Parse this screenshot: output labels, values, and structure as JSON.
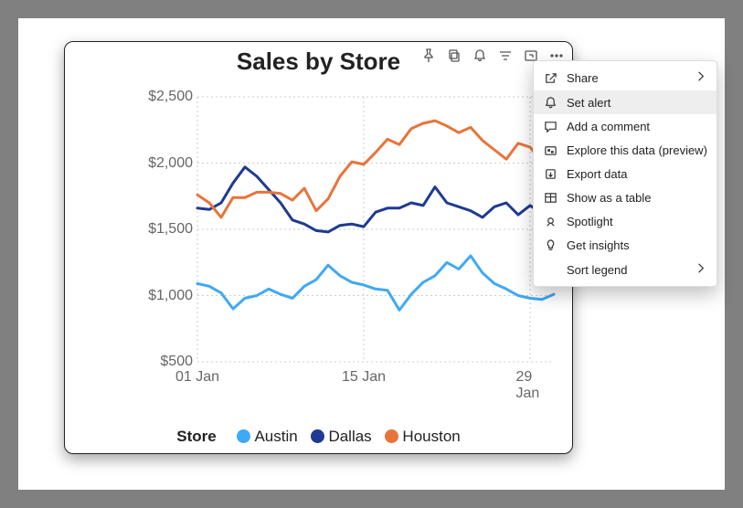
{
  "title": "Sales by Store",
  "y_ticks": [
    "$2,500",
    "$2,000",
    "$1,500",
    "$1,000",
    "$500"
  ],
  "x_ticks": [
    "01 Jan",
    "15 Jan",
    "29 Jan"
  ],
  "legend_title": "Store",
  "legend": [
    {
      "label": "Austin",
      "color": "#3fa9f5"
    },
    {
      "label": "Dallas",
      "color": "#1f3a93"
    },
    {
      "label": "Houston",
      "color": "#e8743b"
    }
  ],
  "menu": {
    "share": "Share",
    "set_alert": "Set alert",
    "add_comment": "Add a comment",
    "explore": "Explore this data (preview)",
    "export": "Export data",
    "show_table": "Show as a table",
    "spotlight": "Spotlight",
    "insights": "Get insights",
    "sort_legend": "Sort legend"
  },
  "chart_data": {
    "type": "line",
    "title": "Sales by Store",
    "xlabel": "",
    "ylabel": "",
    "ylim": [
      500,
      2500
    ],
    "x": [
      "01 Jan",
      "02 Jan",
      "03 Jan",
      "04 Jan",
      "05 Jan",
      "06 Jan",
      "07 Jan",
      "08 Jan",
      "09 Jan",
      "10 Jan",
      "11 Jan",
      "12 Jan",
      "13 Jan",
      "14 Jan",
      "15 Jan",
      "16 Jan",
      "17 Jan",
      "18 Jan",
      "19 Jan",
      "20 Jan",
      "21 Jan",
      "22 Jan",
      "23 Jan",
      "24 Jan",
      "25 Jan",
      "26 Jan",
      "27 Jan",
      "28 Jan",
      "29 Jan",
      "30 Jan",
      "31 Jan"
    ],
    "series": [
      {
        "name": "Austin",
        "color": "#3fa9f5",
        "values": [
          1090,
          1070,
          1020,
          900,
          980,
          1000,
          1050,
          1010,
          980,
          1070,
          1120,
          1230,
          1150,
          1100,
          1080,
          1050,
          1040,
          890,
          1010,
          1100,
          1150,
          1250,
          1200,
          1300,
          1170,
          1090,
          1050,
          1000,
          980,
          970,
          1010
        ]
      },
      {
        "name": "Dallas",
        "color": "#1f3a93",
        "values": [
          1660,
          1650,
          1700,
          1850,
          1970,
          1900,
          1800,
          1700,
          1570,
          1540,
          1490,
          1480,
          1530,
          1540,
          1520,
          1630,
          1660,
          1660,
          1700,
          1680,
          1820,
          1700,
          1670,
          1640,
          1590,
          1670,
          1700,
          1610,
          1680,
          1620,
          1670
        ]
      },
      {
        "name": "Houston",
        "color": "#e8743b",
        "values": [
          1760,
          1700,
          1590,
          1740,
          1740,
          1780,
          1780,
          1770,
          1720,
          1810,
          1640,
          1730,
          1900,
          2010,
          1990,
          2080,
          2180,
          2140,
          2260,
          2300,
          2320,
          2280,
          2230,
          2270,
          2170,
          2100,
          2030,
          2150,
          2120,
          2010,
          2040
        ]
      }
    ]
  }
}
